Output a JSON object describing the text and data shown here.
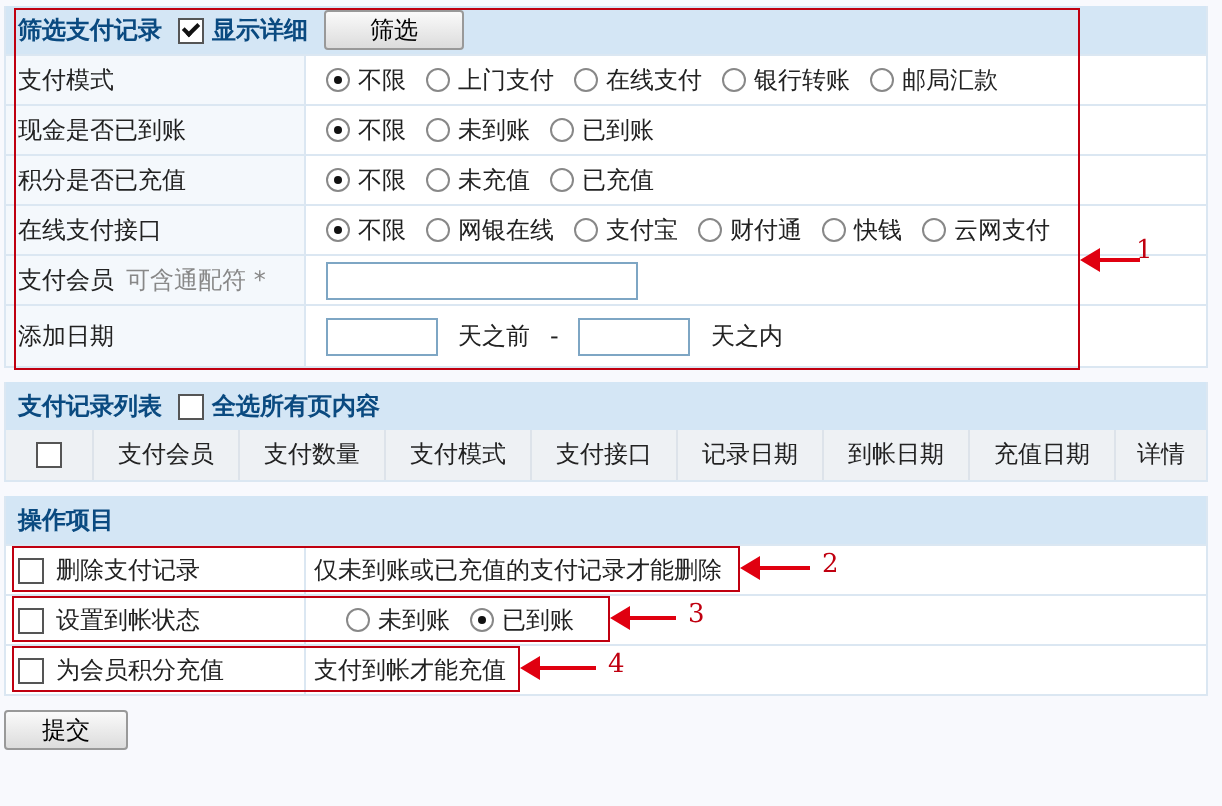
{
  "filter": {
    "title": "筛选支付记录",
    "show_details": {
      "label": "显示详细",
      "checked": true
    },
    "button": "筛选",
    "rows": [
      {
        "kind": "radio",
        "label": "支付模式",
        "options": [
          {
            "label": "不限",
            "selected": true
          },
          {
            "label": "上门支付",
            "selected": false
          },
          {
            "label": "在线支付",
            "selected": false
          },
          {
            "label": "银行转账",
            "selected": false
          },
          {
            "label": "邮局汇款",
            "selected": false
          }
        ]
      },
      {
        "kind": "radio",
        "label": "现金是否已到账",
        "options": [
          {
            "label": "不限",
            "selected": true
          },
          {
            "label": "未到账",
            "selected": false
          },
          {
            "label": "已到账",
            "selected": false
          }
        ]
      },
      {
        "kind": "radio",
        "label": "积分是否已充值",
        "options": [
          {
            "label": "不限",
            "selected": true
          },
          {
            "label": "未充值",
            "selected": false
          },
          {
            "label": "已充值",
            "selected": false
          }
        ]
      },
      {
        "kind": "radio",
        "label": "在线支付接口",
        "options": [
          {
            "label": "不限",
            "selected": true
          },
          {
            "label": "网银在线",
            "selected": false
          },
          {
            "label": "支付宝",
            "selected": false
          },
          {
            "label": "财付通",
            "selected": false
          },
          {
            "label": "快钱",
            "selected": false
          },
          {
            "label": "云网支付",
            "selected": false
          }
        ]
      },
      {
        "kind": "text",
        "label": "支付会员",
        "hint": "可含通配符 *"
      },
      {
        "kind": "range",
        "label": "添加日期",
        "before": "天之前",
        "separator": "-",
        "after": "天之内"
      }
    ]
  },
  "list": {
    "title": "支付记录列表",
    "select_all": {
      "label": "全选所有页内容",
      "checked": false
    },
    "header_checked": false,
    "columns": [
      "支付会员",
      "支付数量",
      "支付模式",
      "支付接口",
      "记录日期",
      "到帐日期",
      "充值日期",
      "详情"
    ]
  },
  "operations": {
    "title": "操作项目",
    "rows": [
      {
        "kind": "note",
        "label": "删除支付记录",
        "checked": false,
        "note": "仅未到账或已充值的支付记录才能删除"
      },
      {
        "kind": "radio",
        "label": "设置到帐状态",
        "checked": false,
        "options": [
          {
            "label": "未到账",
            "selected": false
          },
          {
            "label": "已到账",
            "selected": true
          }
        ]
      },
      {
        "kind": "note",
        "label": "为会员积分充值",
        "checked": false,
        "note": "支付到帐才能充值"
      }
    ]
  },
  "submit": "提交",
  "annotations": [
    "1",
    "2",
    "3",
    "4"
  ]
}
